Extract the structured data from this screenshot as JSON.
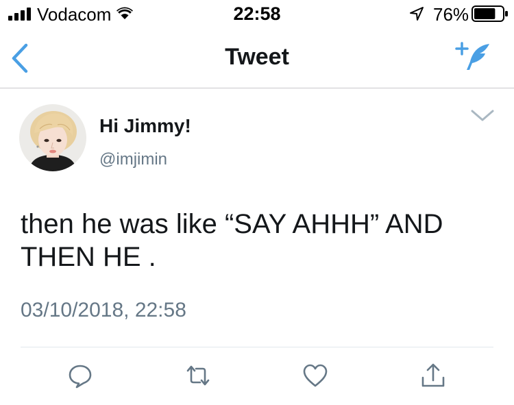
{
  "status_bar": {
    "carrier": "Vodacom",
    "time": "22:58",
    "battery_percent": "76%",
    "battery_level": 0.76,
    "icons": [
      "signal-icon",
      "wifi-icon",
      "location-arrow-icon",
      "battery-icon"
    ]
  },
  "nav": {
    "title": "Tweet",
    "back_icon": "chevron-left-icon",
    "compose_icon": "compose-feather-icon"
  },
  "tweet": {
    "display_name": "Hi Jimmy!",
    "handle": "@imjimin",
    "text": "then he was like “SAY AHHH” AND THEN HE .",
    "timestamp": "03/10/2018, 22:58"
  },
  "actions": [
    "reply-icon",
    "retweet-icon",
    "like-icon",
    "share-icon"
  ],
  "colors": {
    "accent": "#4a9fe4",
    "text_primary": "#14171a",
    "text_secondary": "#657786",
    "icon_gray": "#657786",
    "divider": "#e1e8ed"
  }
}
